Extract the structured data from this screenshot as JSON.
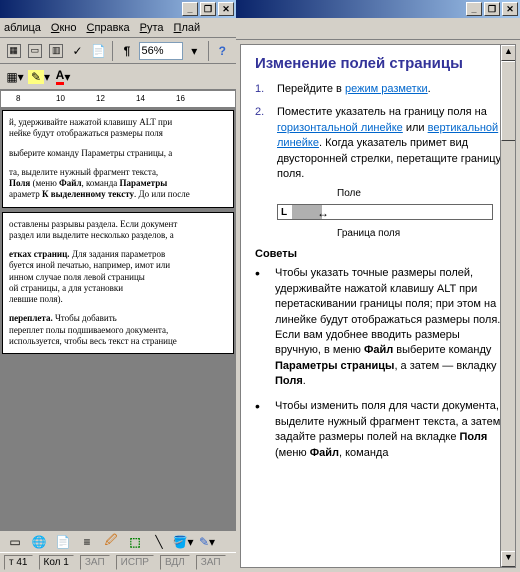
{
  "left": {
    "menu": {
      "tablica": "аблица",
      "okno": "Окно",
      "spravka": "Справка",
      "ruta": "Рута",
      "play": "Плай"
    },
    "zoom": "56%",
    "ruler": [
      "8",
      "10",
      "12",
      "14",
      "16"
    ],
    "doc1": {
      "l1": "й, удерживайте нажатой клавишу ALT при",
      "l2": "нейке будут отображаться размеры поля",
      "l3": "выберите команду Параметры страницы, а",
      "l4": "та, выделите нужный фрагмент текста,",
      "l5a": "Поля",
      "l5b": " (меню ",
      "l5c": "Файл",
      "l5d": ", команда ",
      "l5e": "Параметры",
      "l6a": "араметр ",
      "l6b": "К выделенному тексту",
      "l6c": ". До или после"
    },
    "doc2": {
      "l1": "оставлены разрывы раздела. Если документ",
      "l2": "раздел или выделите несколько разделов, а",
      "h1": "етках страниц.",
      "l3": " Для задания параметров",
      "l4": "буется иной печатью, например, имот или",
      "l5": "инном случае поля левой страницы",
      "l6": "ой страницы, а для установки",
      "l7": " левшие поля).",
      "h2": "переплета.",
      "l8": " Чтобы добавить",
      "l9": "переплет полы подшиваемого документа,",
      "l10": "используется, чтобы весь текст на странице"
    },
    "status": {
      "t": "т",
      "tval": "41",
      "kol": "Кол",
      "kolval": "1",
      "zap": "ЗАП",
      "ispr": "ИСПР",
      "vdl": "ВДЛ",
      "zap2": "ЗАП"
    }
  },
  "help": {
    "title": "Изменение полей страницы",
    "ol1": {
      "num": "1.",
      "pre": "Перейдите в ",
      "link": "режим разметки",
      "post": "."
    },
    "ol2": {
      "num": "2.",
      "l1": "Поместите указатель на границу поля на ",
      "link1": "горизонтальной линейке",
      "l2": " или ",
      "link2": "вертикальной линейке",
      "l3": ". Когда указатель примет вид двусторонней стрелки, перетащите границу поля."
    },
    "diag": {
      "pole": "Поле",
      "granica": "Граница поля"
    },
    "tips_h": "Советы",
    "ul1": {
      "l": "Чтобы указать точные размеры полей, удерживайте нажатой клавишу ALT при перетаскивании границы поля; при этом на линейке будут отображаться размеры поля. Если вам удобнее вводить размеры вручную, в меню ",
      "b1": "Файл",
      "l2": " выберите команду ",
      "b2": "Параметры страницы",
      "l3": ", а затем — вкладку ",
      "b3": "Поля",
      "l4": "."
    },
    "ul2": {
      "l": "Чтобы изменить поля для части документа, выделите нужный фрагмент текста, а затем задайте размеры полей на вкладке ",
      "b1": "Поля",
      "l2": " (меню ",
      "b2": "Файл",
      "l3": ", команда"
    }
  }
}
